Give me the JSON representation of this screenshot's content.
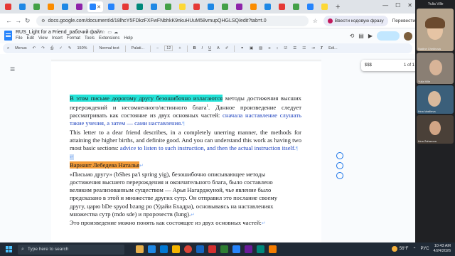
{
  "browser": {
    "url": "docs.google.com/document/d/18lhcY5FDkzFXFwFNbhkK9nkuHUuM58vmupQHGLSQ/edit?tab=t.0",
    "translate_chip": "Ввести кодовую фразу",
    "translate_action": "Перевести"
  },
  "doc": {
    "title": "RUS_Light for a Friend_рабочий файл",
    "menu": [
      "File",
      "Edit",
      "View",
      "Insert",
      "Format",
      "Tools",
      "Extensions",
      "Help"
    ]
  },
  "toolbar": {
    "menus": "Menus",
    "zoom": "150%",
    "style": "Normal text",
    "font": "Palati...",
    "size": "12",
    "mode": "Edi..."
  },
  "find": {
    "query": "$$$",
    "count": "1 of 1"
  },
  "content": {
    "p1_highlight": "В этом письме дорогому другу безошибочно излагаются",
    "p1_rest": " методы достижения высших перерождений и несомненного/истинного блага",
    "p1_sup": "1",
    "p1_cont": ". Данное произведение следует рассматривать как состояние из двух основных частей: ",
    "p1_blue": "сначала наставление слушать такие учения, а затем — сами наставления.",
    "p2_text": "This letter to a dear friend describes, in a completely unerring manner, the methods for attaining the higher births, and definite good. And you can understand this work as having two most basic sections: ",
    "p2_blue": "advice to listen to such instruction, and then the actual instruction itself.",
    "heading": "Вариант Лебедева Наталья",
    "p3_lines": [
      "«Письмо другу» (bShes pa'i spring yig), безошибочно описывающее методы",
      "достижения высшего перерождения и окончательного блага, было составлено",
      "великим реализованным существом — Арья Нагарджуной, чье явление было",
      "предсказано в этой и множестве других сутр. Он отправил это послание своему",
      "другу, царю bDe spyod bzang po (Удайи Бхадра), основываясь на наставлениях",
      "множества сутр (mdo sde) и пророчеств (lung)."
    ],
    "p4": "Это произведение можно понять как состоящее из двух основных частей:"
  },
  "meeting": {
    "label": "Yulia Ville",
    "participants": [
      "Nadine Chekhova",
      "Yulia Ville",
      "Irina Vasilieva",
      "Irina Zaharova"
    ]
  },
  "taskbar": {
    "search_placeholder": "Type here to search",
    "weather": "56°F",
    "lang": "РУС",
    "time": "10:43 AM",
    "date": "4/24/2026"
  },
  "colors": {
    "highlight_cyan": "#24e3d8",
    "highlight_orange": "#f39c39",
    "link_blue": "#1a3fbd"
  }
}
